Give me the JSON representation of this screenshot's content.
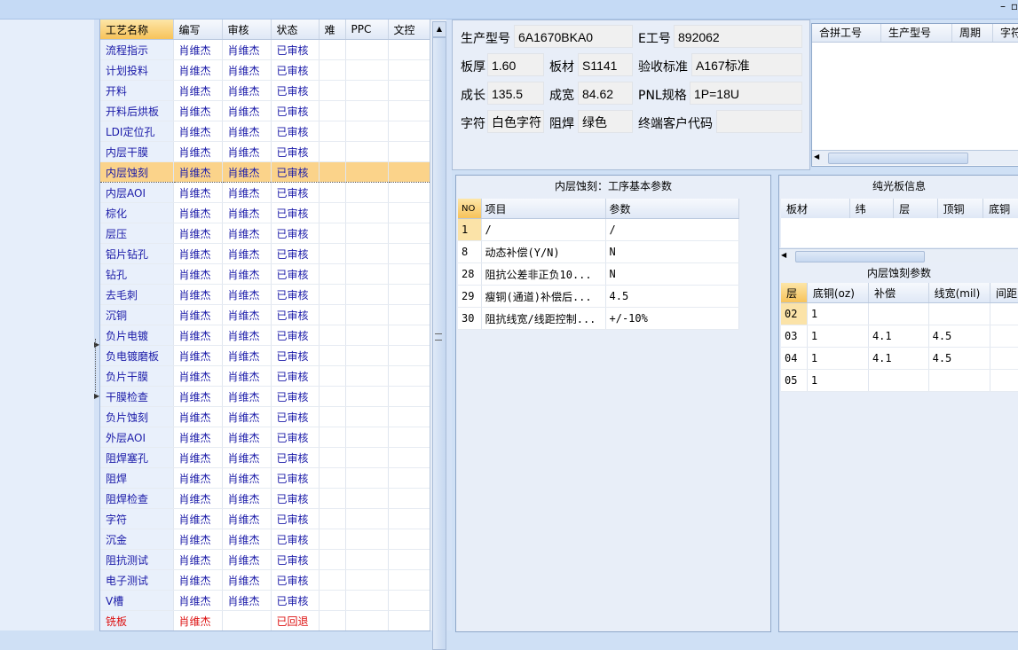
{
  "window": {
    "min_glyph": "–",
    "edge_glyph": "▫"
  },
  "process_list": {
    "headers": [
      "工艺名称",
      "编写",
      "审核",
      "状态",
      "难",
      "PPC",
      "文控"
    ],
    "rows": [
      [
        "流程指示",
        "肖维杰",
        "肖维杰",
        "已审核"
      ],
      [
        "计划投料",
        "肖维杰",
        "肖维杰",
        "已审核"
      ],
      [
        "开料",
        "肖维杰",
        "肖维杰",
        "已审核"
      ],
      [
        "开料后烘板",
        "肖维杰",
        "肖维杰",
        "已审核"
      ],
      [
        "LDI定位孔",
        "肖维杰",
        "肖维杰",
        "已审核"
      ],
      [
        "内层干膜",
        "肖维杰",
        "肖维杰",
        "已审核"
      ],
      [
        "内层蚀刻",
        "肖维杰",
        "肖维杰",
        "已审核"
      ],
      [
        "内层AOI",
        "肖维杰",
        "肖维杰",
        "已审核"
      ],
      [
        "棕化",
        "肖维杰",
        "肖维杰",
        "已审核"
      ],
      [
        "层压",
        "肖维杰",
        "肖维杰",
        "已审核"
      ],
      [
        "铝片钻孔",
        "肖维杰",
        "肖维杰",
        "已审核"
      ],
      [
        "钻孔",
        "肖维杰",
        "肖维杰",
        "已审核"
      ],
      [
        "去毛刺",
        "肖维杰",
        "肖维杰",
        "已审核"
      ],
      [
        "沉铜",
        "肖维杰",
        "肖维杰",
        "已审核"
      ],
      [
        "负片电镀",
        "肖维杰",
        "肖维杰",
        "已审核"
      ],
      [
        "负电镀磨板",
        "肖维杰",
        "肖维杰",
        "已审核"
      ],
      [
        "负片干膜",
        "肖维杰",
        "肖维杰",
        "已审核"
      ],
      [
        "干膜检查",
        "肖维杰",
        "肖维杰",
        "已审核"
      ],
      [
        "负片蚀刻",
        "肖维杰",
        "肖维杰",
        "已审核"
      ],
      [
        "外层AOI",
        "肖维杰",
        "肖维杰",
        "已审核"
      ],
      [
        "阻焊塞孔",
        "肖维杰",
        "肖维杰",
        "已审核"
      ],
      [
        "阻焊",
        "肖维杰",
        "肖维杰",
        "已审核"
      ],
      [
        "阻焊检查",
        "肖维杰",
        "肖维杰",
        "已审核"
      ],
      [
        "字符",
        "肖维杰",
        "肖维杰",
        "已审核"
      ],
      [
        "沉金",
        "肖维杰",
        "肖维杰",
        "已审核"
      ],
      [
        "阻抗测试",
        "肖维杰",
        "肖维杰",
        "已审核"
      ],
      [
        "电子测试",
        "肖维杰",
        "肖维杰",
        "已审核"
      ],
      [
        "V槽",
        "肖维杰",
        "肖维杰",
        "已审核"
      ],
      [
        "铣板",
        "肖维杰",
        "",
        "已回退"
      ]
    ],
    "selected_index": 6,
    "returned_index": 28
  },
  "info": {
    "model_label": "生产型号",
    "model_value": "6A1670BKA0",
    "e_no_label": "E工号",
    "e_no_value": "892062",
    "thickness_label": "板厚",
    "thickness_value": "1.60",
    "material_label": "板材",
    "material_value": "S1141",
    "standard_label": "验收标准",
    "standard_value": "A167标准",
    "length_label": "成长",
    "length_value": "135.5",
    "width_label": "成宽",
    "width_value": "84.62",
    "pnl_label": "PNL规格",
    "pnl_value": "1P=18U",
    "char_label": "字符",
    "char_value": "白色字符",
    "mask_label": "阻焊",
    "mask_value": "绿色",
    "customer_label": "终端客户代码",
    "customer_value": ""
  },
  "merge_table": {
    "headers": [
      "合拼工号",
      "生产型号",
      "周期",
      "字符"
    ]
  },
  "params_panel": {
    "title": "内层蚀刻：工序基本参数",
    "headers": [
      "NO",
      "项目",
      "参数"
    ],
    "rows": [
      [
        "1",
        "/",
        "/"
      ],
      [
        "8",
        "动态补偿(Y/N)",
        "N"
      ],
      [
        "28",
        "阻抗公差非正负10...",
        "N"
      ],
      [
        "29",
        "瘦铜(通道)补偿后...",
        "4.5"
      ],
      [
        "30",
        "阻抗线宽/线距控制...",
        "+/-10%"
      ]
    ]
  },
  "bare_board": {
    "title": "纯光板信息",
    "headers": [
      "板材",
      "纬",
      "层",
      "顶铜",
      "底铜"
    ]
  },
  "etch_params": {
    "title": "内层蚀刻参数",
    "headers": [
      "层",
      "底铜(oz)",
      "补偿",
      "线宽(mil)",
      "间距"
    ],
    "rows": [
      [
        "02",
        "1",
        "",
        "",
        ""
      ],
      [
        "03",
        "1",
        "4.1",
        "4.5",
        ""
      ],
      [
        "04",
        "1",
        "4.1",
        "4.5",
        ""
      ],
      [
        "05",
        "1",
        "",
        "",
        ""
      ]
    ]
  }
}
